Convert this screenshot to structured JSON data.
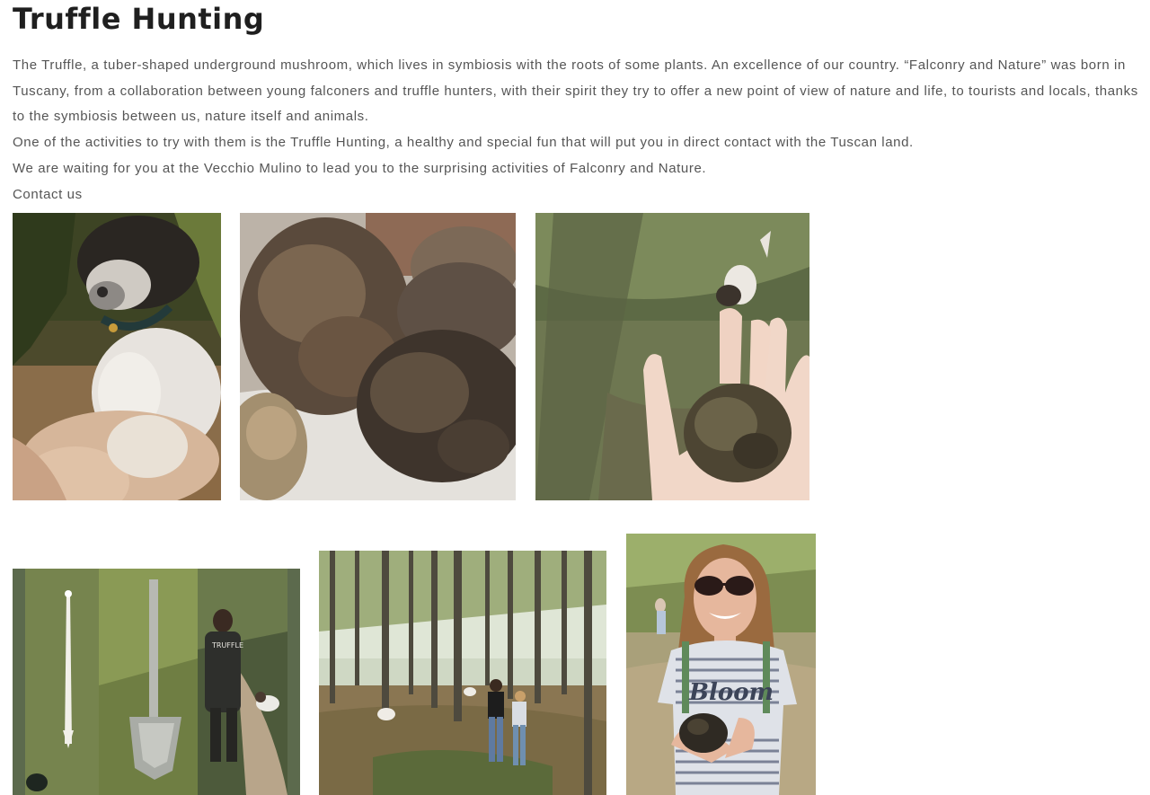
{
  "page": {
    "title": "Truffle Hunting",
    "paragraphs": [
      "The Truffle, a tuber-shaped underground mushroom, which lives in symbiosis with the roots of some plants. An excellence of our country. “Falconry and Nature” was born in Tuscany, from a collaboration between young falconers and truffle hunters, with their spirit they try to offer a new point of view of nature and life, to tourists and locals, thanks to the symbiosis between us, nature itself and animals.",
      "One of the activities to try with them is the Truffle Hunting, a healthy and special fun that will put you in direct contact with the Tuscan land.",
      "We are waiting for you at the Vecchio Mulino to lead you to the surprising activities of Falconry and Nature."
    ],
    "contact_link": "Contact us"
  },
  "photos": {
    "shirt_text": "Bloom",
    "jacket_text": "TRUFFLE"
  },
  "colors": {
    "text": "#555555",
    "heading": "#1f1f1f",
    "collage_border": "#5c6a4d"
  }
}
